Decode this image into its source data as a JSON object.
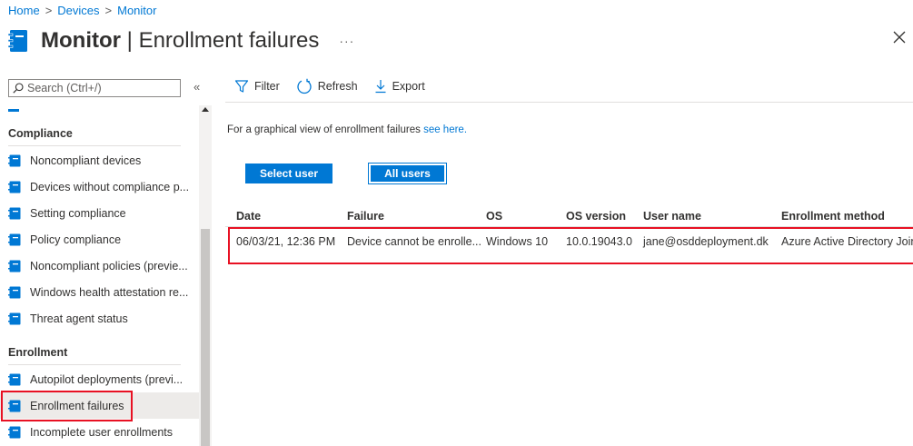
{
  "breadcrumb": {
    "home": "Home",
    "devices": "Devices",
    "monitor": "Monitor",
    "sep": ">"
  },
  "header": {
    "title_bold": "Monitor",
    "title_divider": "|",
    "title_rest": "Enrollment failures",
    "more": "···",
    "close": "✕"
  },
  "sidebar": {
    "search_placeholder": "Search (Ctrl+/)",
    "collapse": "«",
    "sections": {
      "compliance": "Compliance",
      "enrollment": "Enrollment"
    },
    "compliance_items": [
      {
        "label": "Noncompliant devices"
      },
      {
        "label": "Devices without compliance p..."
      },
      {
        "label": "Setting compliance"
      },
      {
        "label": "Policy compliance"
      },
      {
        "label": "Noncompliant policies (previe..."
      },
      {
        "label": "Windows health attestation re..."
      },
      {
        "label": "Threat agent status"
      }
    ],
    "enrollment_items": [
      {
        "label": "Autopilot deployments (previ..."
      },
      {
        "label": "Enrollment failures",
        "selected": true
      },
      {
        "label": "Incomplete user enrollments"
      }
    ]
  },
  "toolbar": {
    "filter": "Filter",
    "refresh": "Refresh",
    "export": "Export"
  },
  "main": {
    "info_prefix": "For a graphical view of enrollment failures",
    "info_link": "see here.",
    "select_user": "Select user",
    "all_users": "All users",
    "table": {
      "headers": [
        "Date",
        "Failure",
        "OS",
        "OS version",
        "User name",
        "Enrollment method"
      ],
      "rows": [
        [
          "06/03/21, 12:36 PM",
          "Device cannot be enrolle...",
          "Windows 10",
          "10.0.19043.0",
          "jane@osddeployment.dk",
          "Azure Active Directory Join"
        ]
      ]
    }
  },
  "colors": {
    "accent": "#0078d4",
    "highlight": "#e81123",
    "selected_bg": "#edebe9"
  }
}
